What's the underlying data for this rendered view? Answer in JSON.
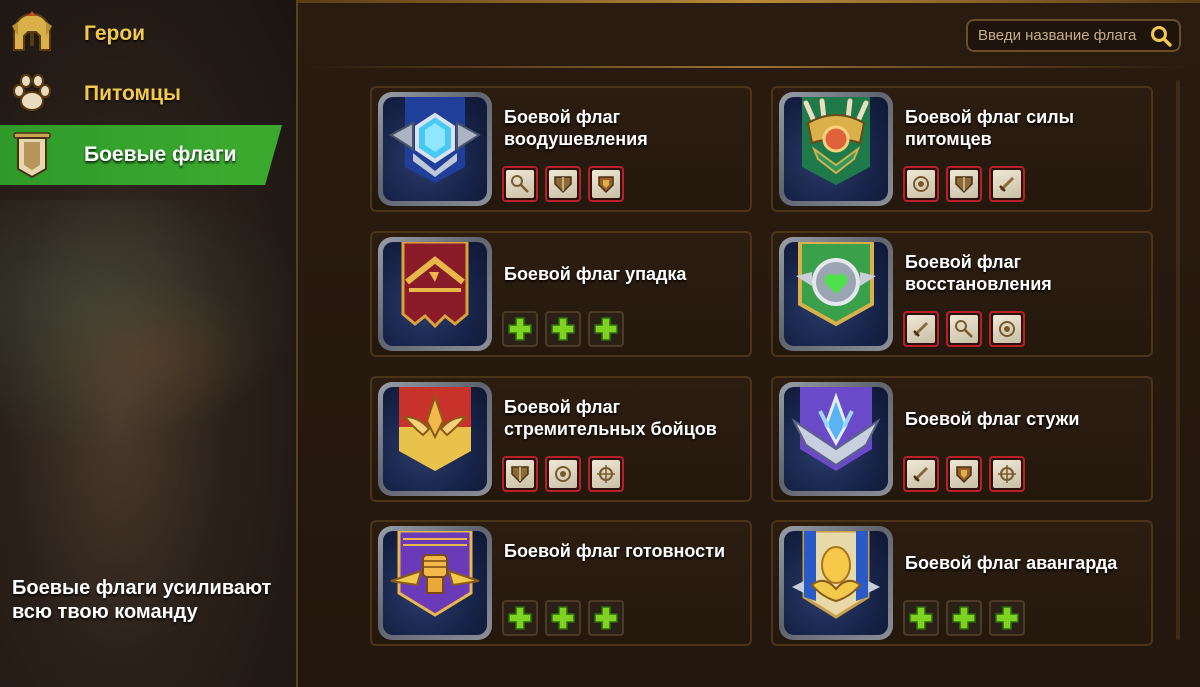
{
  "sidebar": {
    "items": [
      {
        "label": "Герои",
        "icon": "spartan-helmet-icon",
        "active": false
      },
      {
        "label": "Питомцы",
        "icon": "paw-icon",
        "active": false
      },
      {
        "label": "Боевые флаги",
        "icon": "banner-icon",
        "active": true
      }
    ],
    "footer": "Боевые флаги усиливают всю твою команду"
  },
  "search": {
    "placeholder": "Введи название флага",
    "icon": "search-icon"
  },
  "colors": {
    "active_tab": "#3aa92e",
    "title_gold": "#f2c94a",
    "rune_border": "#b8202a",
    "empty_plus": "#7ed321"
  },
  "flags": [
    {
      "title": "Боевой флаг воодушевления",
      "emblem": "blue-crystal-banner",
      "slots": [
        "rune-staff",
        "rune-shield",
        "rune-shield"
      ]
    },
    {
      "title": "Боевой флаг силы питомцев",
      "emblem": "green-antler-banner",
      "slots": [
        "rune-orb",
        "rune-shield",
        "rune-sword"
      ]
    },
    {
      "title": "Боевой флаг упадка",
      "emblem": "red-crown-banner",
      "slots": [
        "empty",
        "empty",
        "empty"
      ]
    },
    {
      "title": "Боевой флаг восстановления",
      "emblem": "green-heart-banner",
      "slots": [
        "rune-sword",
        "rune-staff",
        "rune-orb"
      ]
    },
    {
      "title": "Боевой флаг стремительных бойцов",
      "emblem": "red-gold-leaf-banner",
      "slots": [
        "rune-shield",
        "rune-orb",
        "rune-target"
      ]
    },
    {
      "title": "Боевой флаг стужи",
      "emblem": "purple-ice-banner",
      "slots": [
        "rune-sword",
        "rune-shield",
        "rune-target"
      ]
    },
    {
      "title": "Боевой флаг готовности",
      "emblem": "purple-fist-banner",
      "slots": [
        "empty",
        "empty",
        "empty"
      ]
    },
    {
      "title": "Боевой флаг авангарда",
      "emblem": "gold-egg-banner",
      "slots": [
        "empty",
        "empty",
        "empty"
      ]
    }
  ]
}
